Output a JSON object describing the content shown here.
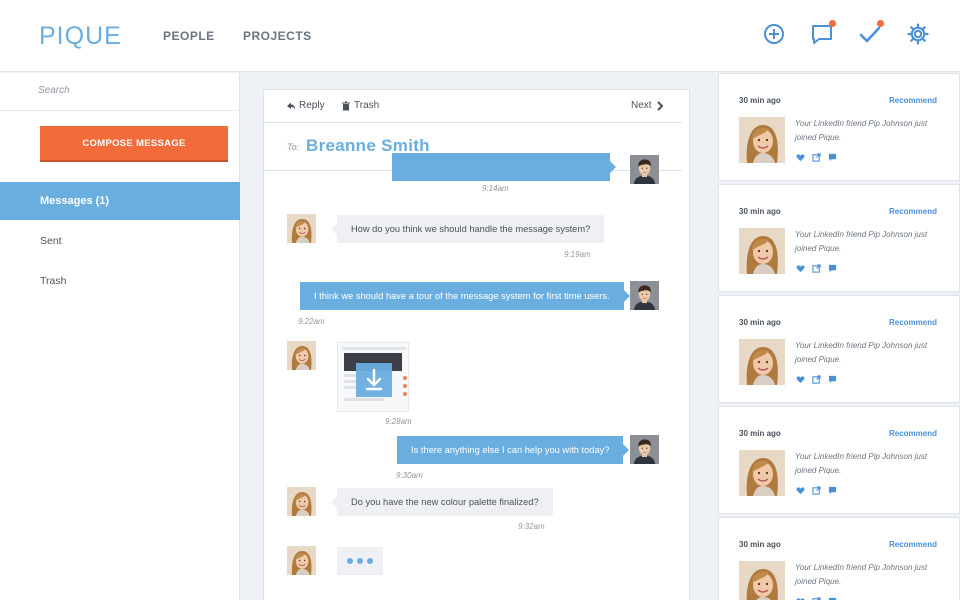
{
  "app": {
    "logo": "PIQUE"
  },
  "nav": {
    "people": "PEOPLE",
    "projects": "PROJECTS"
  },
  "top_icons": [
    "add-circle-icon",
    "chat-icon",
    "check-icon",
    "gear-icon"
  ],
  "colors": {
    "accent": "#6aaee0",
    "compose": "#f26b3a",
    "notification": "#f26b3a",
    "link": "#4a90d9"
  },
  "sidebar": {
    "search_placeholder": "Search",
    "compose_label": "COMPOSE MESSAGE",
    "items": [
      {
        "label": "Messages (1)",
        "active": true
      },
      {
        "label": "Sent",
        "active": false
      },
      {
        "label": "Trash",
        "active": false
      }
    ]
  },
  "message": {
    "reply_label": "Reply",
    "trash_label": "Trash",
    "next_label": "Next",
    "to_label": "To:",
    "recipient": "Breanne Smith",
    "thread": [
      {
        "from": "me",
        "text": "",
        "time": "9:14am"
      },
      {
        "from": "them",
        "text": "How do you think we should handle the message system?",
        "time": "9:19am"
      },
      {
        "from": "me",
        "text": "I think we should have a tour of the message system for first time users.",
        "time": "9:22am"
      },
      {
        "from": "them",
        "attachment": true,
        "time": "9:28am"
      },
      {
        "from": "me",
        "text": "Is there anything else I can help you with today?",
        "time": "9:30am"
      },
      {
        "from": "them",
        "text": "Do you have the new colour palette finalized?",
        "time": "9:32am"
      },
      {
        "from": "them",
        "typing": true
      }
    ]
  },
  "feed": {
    "cards": [
      {
        "time": "30 min ago",
        "recommend": "Recommend",
        "text": "Your LinkedIn friend Pip Johnson just joined Pique."
      },
      {
        "time": "30 min ago",
        "recommend": "Recommend",
        "text": "Your LinkedIn friend Pip Johnson just joined Pique."
      },
      {
        "time": "30 min ago",
        "recommend": "Recommend",
        "text": "Your LinkedIn friend Pip Johnson just joined Pique."
      },
      {
        "time": "30 min ago",
        "recommend": "Recommend",
        "text": "Your LinkedIn friend Pip Johnson just joined Pique."
      },
      {
        "time": "30 min ago",
        "recommend": "Recommend",
        "text": "Your LinkedIn friend Pip Johnson just joined Pique."
      }
    ]
  }
}
